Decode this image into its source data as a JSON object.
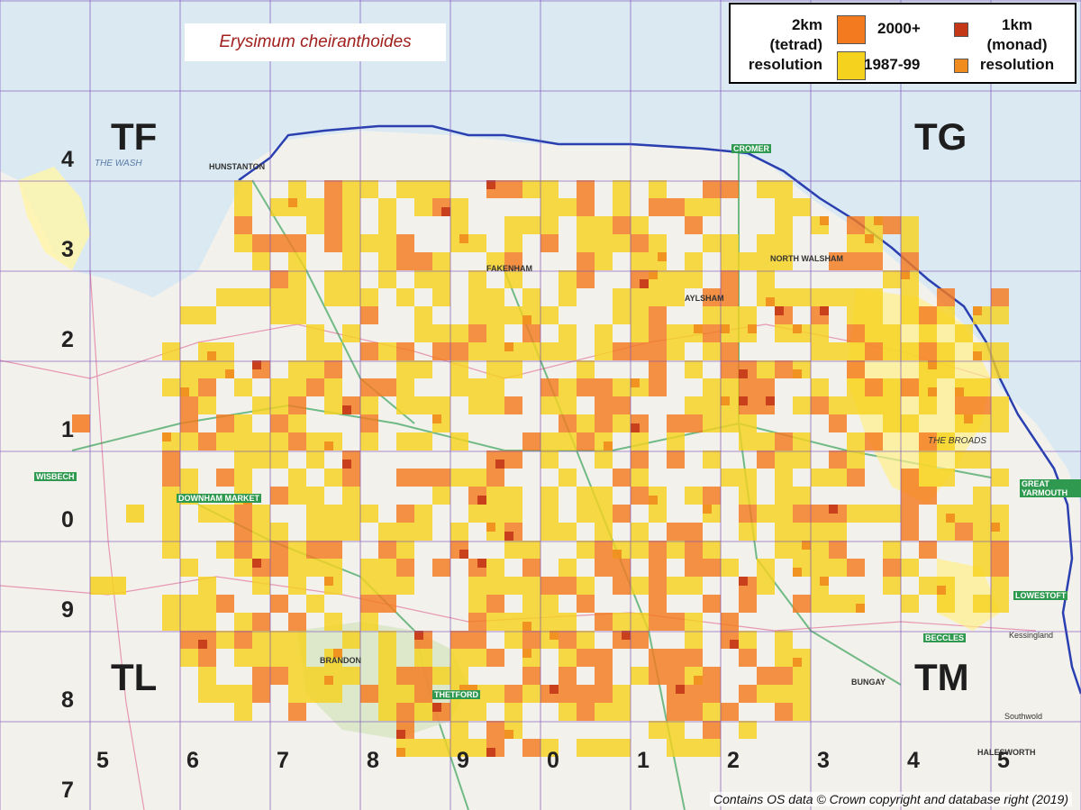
{
  "title": "Erysimum cheiranthoides",
  "legend": {
    "tetrad_label": [
      "2km",
      "(tetrad)",
      "resolution"
    ],
    "monad_label": [
      "1km",
      "(monad)",
      "resolution"
    ],
    "period_recent": "2000+",
    "period_old": "1987-99"
  },
  "colors": {
    "recent_tetrad": "#f47a1f",
    "old_tetrad": "#f5d21e",
    "recent_monad": "#c43818",
    "old_monad": "#f08c1e",
    "grid_line": "#7a52b8",
    "coast": "#2a3fb0",
    "land": "#f3f1ec",
    "sea": "#dbe9f3"
  },
  "grid_squares": [
    "TF",
    "TG",
    "TL",
    "TM"
  ],
  "easting_digits": [
    "5",
    "6",
    "7",
    "8",
    "9",
    "0",
    "1",
    "2",
    "3",
    "4",
    "5"
  ],
  "northing_digits": [
    "4",
    "3",
    "2",
    "1",
    "0",
    "9",
    "8",
    "7"
  ],
  "map_places": [
    "HUNSTANTON",
    "CROMER",
    "NORTH WALSHAM",
    "AYLSHAM",
    "FAKENHAM",
    "WISBECH",
    "DOWNHAM MARKET",
    "THETFORD",
    "BRANDON",
    "GREAT YARMOUTH",
    "LOWESTOFT",
    "BECCLES",
    "BUNGAY",
    "HALESWORTH",
    "THE BROADS",
    "THE WASH",
    "Kessingland",
    "Southwold"
  ],
  "copyright": "Contains OS data © Crown copyright and database right (2019)"
}
